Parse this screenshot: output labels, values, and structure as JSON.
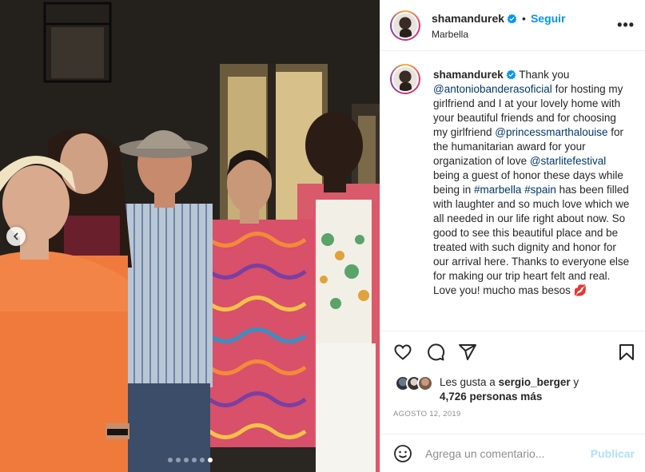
{
  "header": {
    "username": "shamandurek",
    "separator": "•",
    "follow_label": "Seguir",
    "location": "Marbella",
    "more_label": "•••"
  },
  "caption": {
    "username": "shamandurek",
    "segments": [
      {
        "text": " Thank you ",
        "link": false
      },
      {
        "text": "@antoniobanderasoficial",
        "link": true
      },
      {
        "text": " for hosting my girlfriend and I at your lovely home with your beautiful friends and for choosing my girlfriend ",
        "link": false
      },
      {
        "text": "@princessmarthalouise",
        "link": true
      },
      {
        "text": " for the humanitarian award for your organization of love ",
        "link": false
      },
      {
        "text": "@starlitefestival",
        "link": true
      },
      {
        "text": " being a guest of honor these days while being in ",
        "link": false
      },
      {
        "text": "#marbella",
        "link": true
      },
      {
        "text": " ",
        "link": false
      },
      {
        "text": "#spain",
        "link": true
      },
      {
        "text": " has been filled with laughter and so much love which we all needed in our life right about now. So good to see this beautiful place and be treated with such dignity and honor for our arrival here. Thanks to everyone else for making our trip heart felt and real. Love you! mucho mas besos 💋",
        "link": false
      }
    ]
  },
  "likes": {
    "prefix": "Les gusta a ",
    "user": "sergio_berger",
    "middle": " y",
    "count_text": "4,726 personas más"
  },
  "date": "AGOSTO 12, 2019",
  "comment": {
    "placeholder": "Agrega un comentario...",
    "publish_label": "Publicar"
  },
  "carousel": {
    "total": 6,
    "active_index": 5
  },
  "colors": {
    "accent": "#0095f6",
    "link": "#00376b",
    "muted": "#8e8e8e",
    "publish_disabled": "#b2dffc"
  }
}
